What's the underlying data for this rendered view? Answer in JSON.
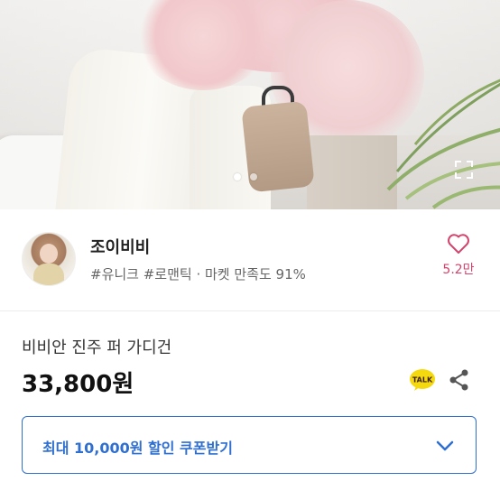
{
  "gallery": {
    "slide_count": 2,
    "active_slide": 1
  },
  "seller": {
    "name": "조이비비",
    "tags": "#유니크 #로맨틱 · 마켓 만족도 91%",
    "like_count": "5.2만"
  },
  "product": {
    "name": "비비안 진주 퍼 가디건",
    "price": "33,800원"
  },
  "coupon": {
    "label": "최대 10,000원 할인 쿠폰받기"
  },
  "icons": {
    "like": "heart-icon",
    "talk": "kakaotalk-icon",
    "share": "share-icon",
    "coupon_toggle": "chevron-down-icon",
    "expand": "expand-icon"
  },
  "colors": {
    "accent_blue": "#2f6fd0",
    "like_pink": "#d2446c",
    "talk_yellow": "#f5d90f"
  }
}
